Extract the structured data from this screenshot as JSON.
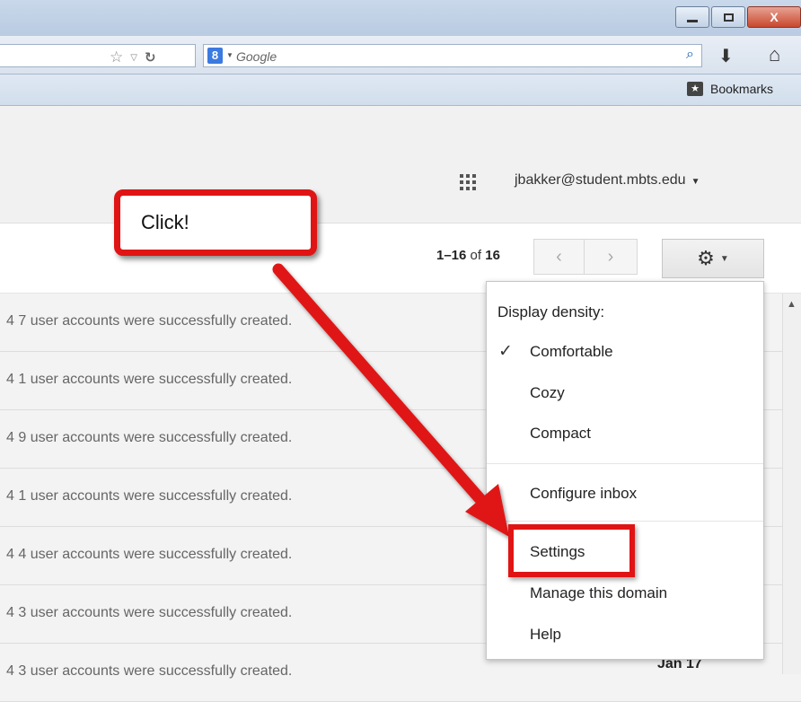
{
  "browser": {
    "search_engine": "Google",
    "bookmarks_label": "Bookmarks"
  },
  "gmail": {
    "account": "jbakker@student.mbts.edu",
    "paging": {
      "range": "1–16",
      "of_label": "of",
      "total": "16"
    }
  },
  "emails": [
    {
      "subject": "4 7 user accounts were successfully created.",
      "date": ""
    },
    {
      "subject": "4 1 user accounts were successfully created.",
      "date": ""
    },
    {
      "subject": "4 9 user accounts were successfully created.",
      "date": ""
    },
    {
      "subject": "4 1 user accounts were successfully created.",
      "date": ""
    },
    {
      "subject": "4 4 user accounts were successfully created.",
      "date": ""
    },
    {
      "subject": "4 3 user accounts were successfully created.",
      "date": ""
    },
    {
      "subject": "4 3 user accounts were successfully created.",
      "date": "Jan 17"
    }
  ],
  "settings_menu": {
    "heading": "Display density:",
    "density_options": [
      "Comfortable",
      "Cozy",
      "Compact"
    ],
    "selected_density": "Comfortable",
    "configure_inbox": "Configure inbox",
    "settings": "Settings",
    "manage_domain": "Manage this domain",
    "help": "Help"
  },
  "annotation": {
    "callout_text": "Click!",
    "accent_color": "#e01414"
  },
  "icons": [
    "star-icon",
    "dropdown-icon",
    "reload-icon",
    "google-icon",
    "search-icon",
    "download-icon",
    "home-icon",
    "bookmarks-star-icon",
    "apps-grid-icon",
    "prev-page-icon",
    "next-page-icon",
    "gear-icon",
    "checkmark-icon"
  ]
}
